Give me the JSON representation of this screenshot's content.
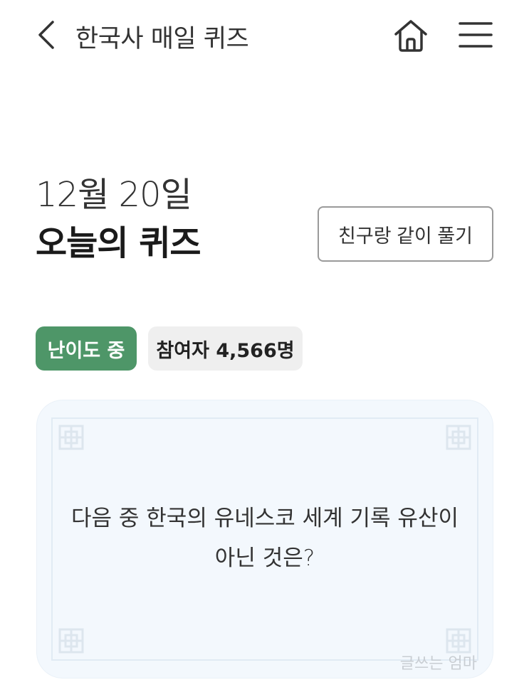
{
  "header": {
    "title": "한국사 매일 퀴즈"
  },
  "quiz": {
    "date": "12월 20일",
    "title": "오늘의 퀴즈",
    "friend_button": "친구랑 같이 풀기",
    "difficulty_badge": "난이도 중",
    "participants_badge": "참여자 4,566명",
    "question_line1": "다음 중 한국의 유네스코 세계 기록 유산이",
    "question_line2": "아닌 것은?"
  },
  "watermark": "글쓰는 엄마",
  "colors": {
    "difficulty_badge": "#4e9668",
    "participants_badge": "#efefef",
    "card_background": "#f3f8fd"
  },
  "icons": {
    "back": "chevron-left-icon",
    "home": "home-icon",
    "menu": "hamburger-menu-icon",
    "corner": "lattice-ornament-icon"
  }
}
